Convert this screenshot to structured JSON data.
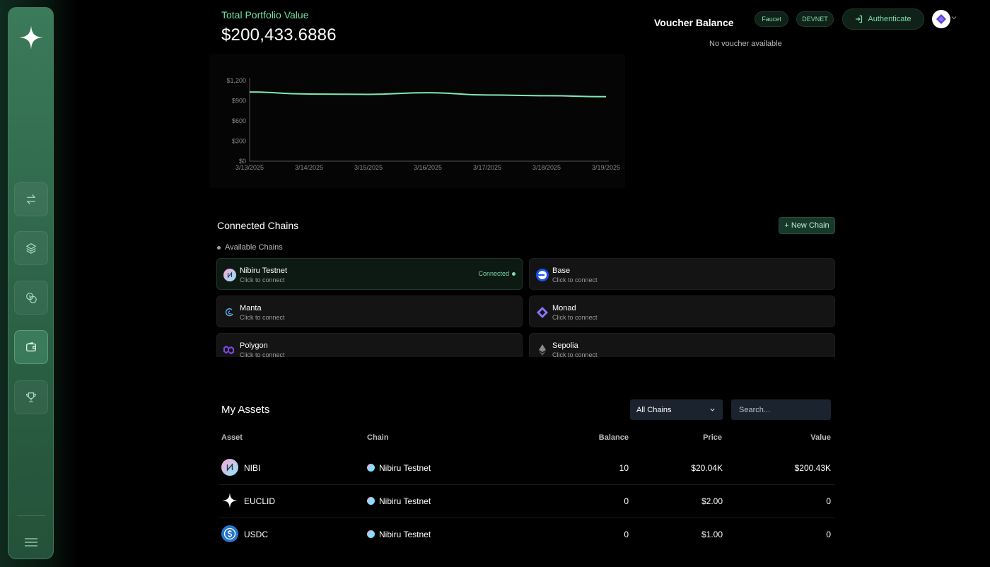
{
  "sidebar": {
    "items": [
      {
        "name": "swap",
        "icon": "swap-arrows-icon"
      },
      {
        "name": "layers",
        "icon": "layers-icon"
      },
      {
        "name": "coins",
        "icon": "coins-icon"
      },
      {
        "name": "wallet",
        "icon": "wallet-icon",
        "active": true
      },
      {
        "name": "trophy",
        "icon": "trophy-icon"
      }
    ]
  },
  "portfolio": {
    "label": "Total Portfolio Value",
    "value": "$200,433.6886"
  },
  "chart_data": {
    "type": "line",
    "x": [
      "3/13/2025",
      "3/14/2025",
      "3/15/2025",
      "3/16/2025",
      "3/17/2025",
      "3/18/2025",
      "3/19/2025"
    ],
    "y_ticks": [
      "$0",
      "$300",
      "$600",
      "$900",
      "$1,200"
    ],
    "ylim": [
      0,
      1200
    ],
    "series": [
      {
        "values": [
          1030,
          1000,
          995,
          1020,
          985,
          975,
          960
        ],
        "color": "#7fe8b8"
      }
    ]
  },
  "voucher": {
    "title": "Voucher Balance",
    "empty_text": "No voucher available"
  },
  "header": {
    "faucet_label": "Faucet",
    "network_label": "DEVNET",
    "auth_label": "Authenticate"
  },
  "chains": {
    "title": "Connected Chains",
    "new_chain_label": "+ New Chain",
    "available_label": "Available Chains",
    "items": [
      {
        "name": "Nibiru Testnet",
        "sub": "Click to connect",
        "status": "Connected",
        "icon": "nibiru-icon"
      },
      {
        "name": "Base",
        "sub": "Click to connect",
        "icon": "base-icon"
      },
      {
        "name": "Manta",
        "sub": "Click to connect",
        "icon": "manta-icon"
      },
      {
        "name": "Monad",
        "sub": "Click to connect",
        "icon": "monad-icon"
      },
      {
        "name": "Polygon",
        "sub": "Click to connect",
        "icon": "polygon-icon"
      },
      {
        "name": "Sepolia",
        "sub": "Click to connect",
        "icon": "ethereum-icon"
      }
    ]
  },
  "assets": {
    "title": "My Assets",
    "filter_value": "All Chains",
    "search_placeholder": "Search...",
    "columns": [
      "Asset",
      "Chain",
      "Balance",
      "Price",
      "Value"
    ],
    "rows": [
      {
        "asset": "NIBI",
        "chain": "Nibiru Testnet",
        "balance": "10",
        "price": "$20.04K",
        "value": "$200.43K",
        "icon": "nibi-icon"
      },
      {
        "asset": "EUCLID",
        "chain": "Nibiru Testnet",
        "balance": "0",
        "price": "$2.00",
        "value": "0",
        "icon": "euclid-icon"
      },
      {
        "asset": "USDC",
        "chain": "Nibiru Testnet",
        "balance": "0",
        "price": "$1.00",
        "value": "0",
        "icon": "usdc-icon"
      }
    ]
  }
}
